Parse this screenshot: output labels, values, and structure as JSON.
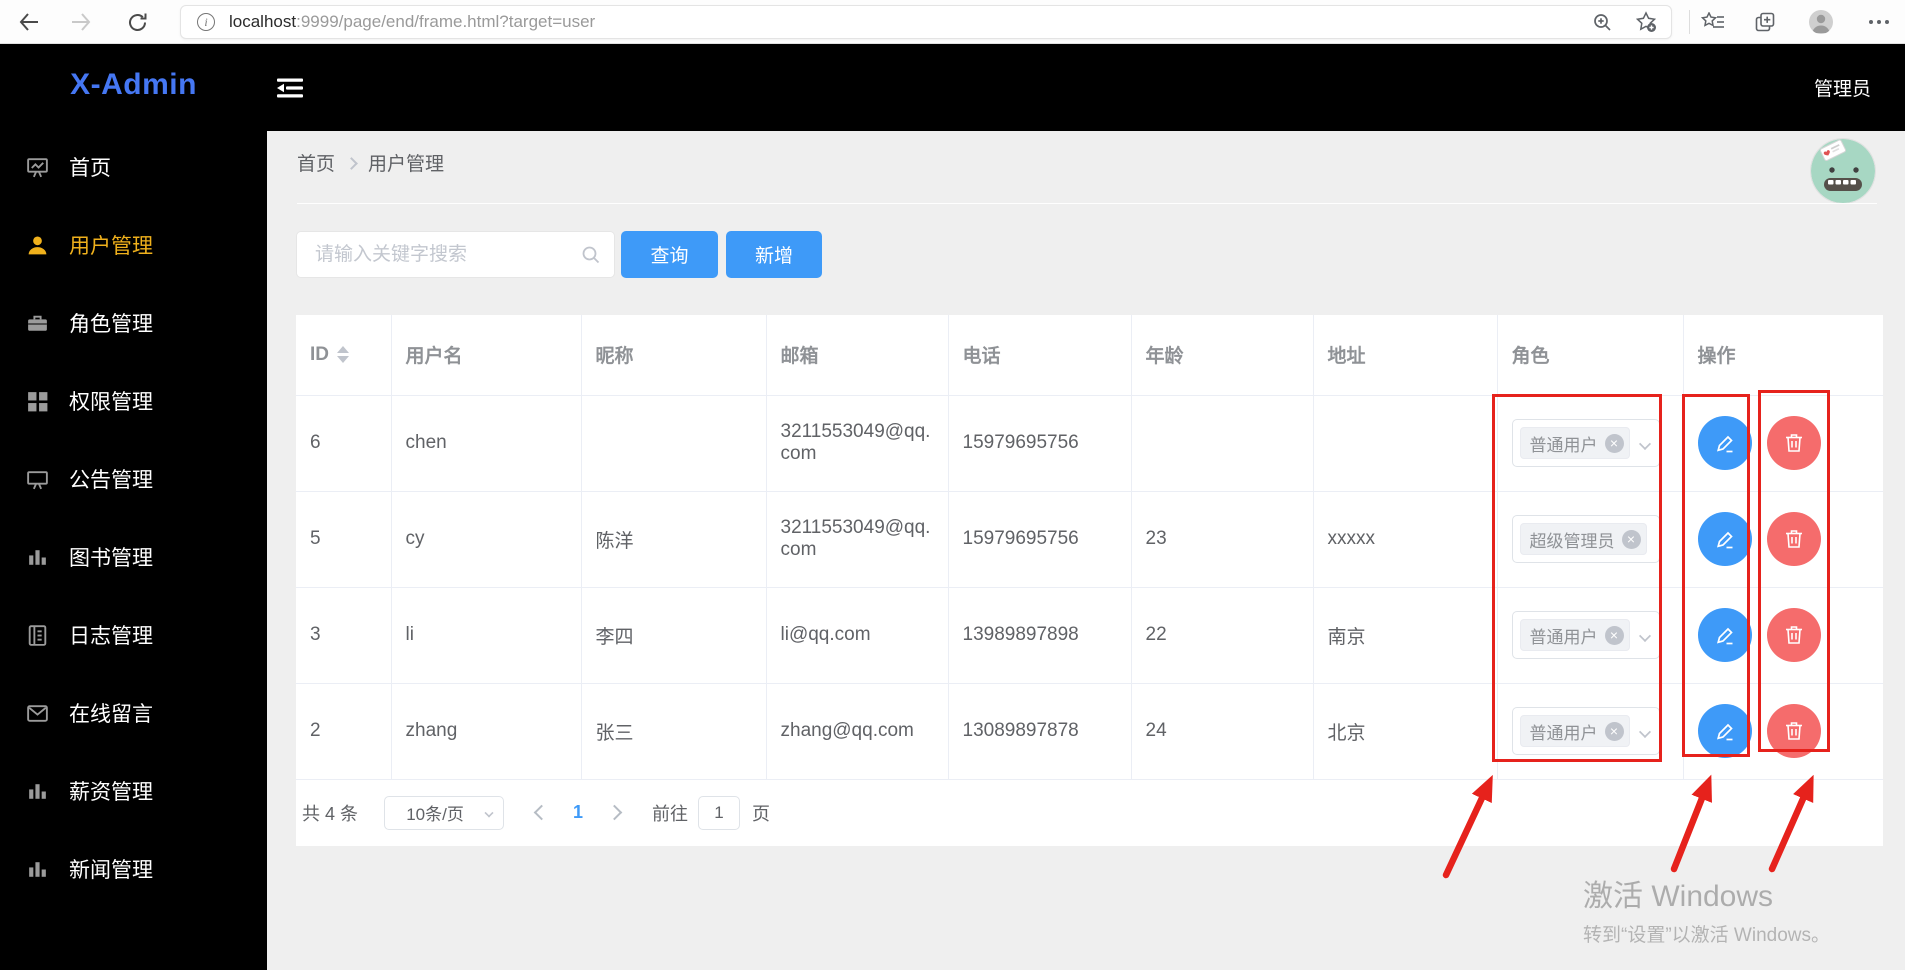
{
  "browser": {
    "url_host": "localhost",
    "url_rest": ":9999/page/end/frame.html?target=user"
  },
  "sidebar": {
    "logo": "X-Admin",
    "items": [
      {
        "label": "首页",
        "icon": "dashboard-board-icon",
        "active": false
      },
      {
        "label": "用户管理",
        "icon": "user-icon",
        "active": true
      },
      {
        "label": "角色管理",
        "icon": "briefcase-icon",
        "active": false
      },
      {
        "label": "权限管理",
        "icon": "grid-icon",
        "active": false
      },
      {
        "label": "公告管理",
        "icon": "board-icon",
        "active": false
      },
      {
        "label": "图书管理",
        "icon": "bar-chart-icon",
        "active": false
      },
      {
        "label": "日志管理",
        "icon": "notebook-icon",
        "active": false
      },
      {
        "label": "在线留言",
        "icon": "mail-icon",
        "active": false
      },
      {
        "label": "薪资管理",
        "icon": "bar-chart-icon",
        "active": false
      },
      {
        "label": "新闻管理",
        "icon": "bar-chart-icon",
        "active": false
      }
    ]
  },
  "header": {
    "user_label": "管理员"
  },
  "breadcrumb": {
    "home": "首页",
    "current": "用户管理"
  },
  "toolbar": {
    "search_placeholder": "请输入关键字搜索",
    "query_label": "查询",
    "add_label": "新增"
  },
  "table": {
    "headers": [
      "ID",
      "用户名",
      "昵称",
      "邮箱",
      "电话",
      "年龄",
      "地址",
      "角色",
      "操作"
    ],
    "rows": [
      {
        "id": "6",
        "username": "chen",
        "nickname": "",
        "email": "3211553049@qq.com",
        "phone": "15979695756",
        "age": "",
        "address": "",
        "role": "普通用户",
        "has_arrow": true
      },
      {
        "id": "5",
        "username": "cy",
        "nickname": "陈洋",
        "email": "3211553049@qq.com",
        "phone": "15979695756",
        "age": "23",
        "address": "xxxxx",
        "role": "超级管理员",
        "has_arrow": false
      },
      {
        "id": "3",
        "username": "li",
        "nickname": "李四",
        "email": "li@qq.com",
        "phone": "13989897898",
        "age": "22",
        "address": "南京",
        "role": "普通用户",
        "has_arrow": true
      },
      {
        "id": "2",
        "username": "zhang",
        "nickname": "张三",
        "email": "zhang@qq.com",
        "phone": "13089897878",
        "age": "24",
        "address": "北京",
        "role": "普通用户",
        "has_arrow": true
      }
    ]
  },
  "pagination": {
    "total": "共 4 条",
    "page_size": "10条/页",
    "current_page": "1",
    "goto_label": "前往",
    "goto_value": "1",
    "page_unit": "页"
  },
  "watermark": {
    "line1": "激活 Windows",
    "line2": "转到“设置”以激活 Windows。"
  },
  "colors": {
    "accent_blue": "#3e9af8",
    "logo_blue": "#4577f3",
    "active_menu_yellow": "#f0b11c",
    "danger_red": "#f56c6c",
    "annotation_red": "#e6221c",
    "sidebar_black": "#000000",
    "content_gray": "#efefef"
  }
}
